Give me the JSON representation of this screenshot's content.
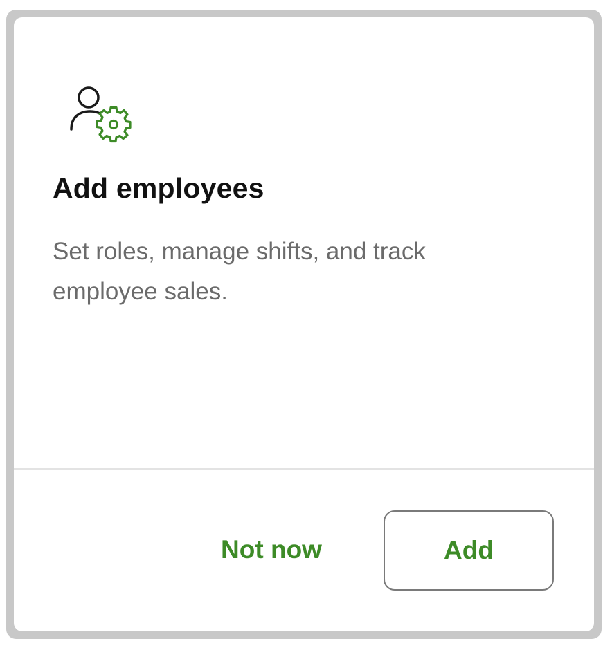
{
  "card": {
    "icon": "employee-settings-icon",
    "title": "Add employees",
    "description": "Set roles, manage shifts, and track employee sales.",
    "actions": {
      "secondary_label": "Not now",
      "primary_label": "Add"
    }
  },
  "colors": {
    "accent_green": "#3d8b27",
    "title_text": "#111111",
    "body_text": "#6b6b6b",
    "button_border": "#7a7a7a",
    "divider": "#e3e3e3",
    "frame_border": "#c8c8c8"
  }
}
